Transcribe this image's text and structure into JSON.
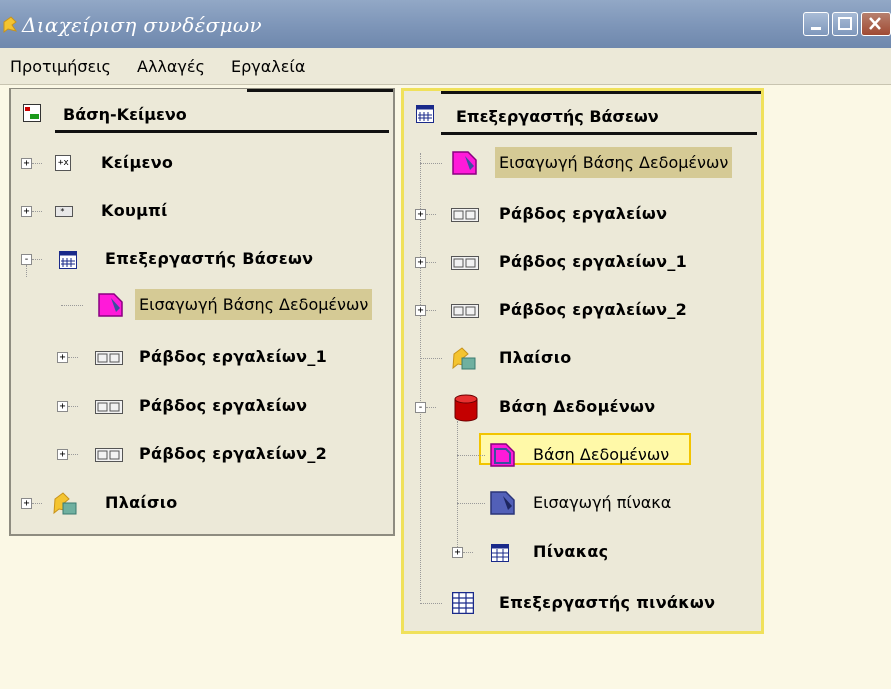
{
  "window": {
    "title": "Διαχείριση συνδέσμων",
    "controls": [
      "minimize",
      "maximize",
      "close"
    ]
  },
  "menu": {
    "items": [
      "Προτιμήσεις",
      "Αλλαγές",
      "Εργαλεία"
    ]
  },
  "left_panel": {
    "header": {
      "label": "Βάση-Κείμενο",
      "icon": "form-icon"
    },
    "rows": [
      {
        "label": "Κείμενο",
        "icon": "textbox-icon",
        "expander": "+"
      },
      {
        "label": "Κουμπί",
        "icon": "button-icon",
        "expander": "+"
      },
      {
        "label": "Επεξεργαστής Βάσεων",
        "icon": "calendar-grid-icon",
        "expander": "-"
      },
      {
        "label": "Εισαγωγή Βάσης Δεδομένων",
        "icon": "db-import-icon",
        "expander": "",
        "highlighted": true
      },
      {
        "label": "Ράβδος εργαλείων_1",
        "icon": "toolbar-icon",
        "expander": "+"
      },
      {
        "label": "Ράβδος εργαλείων",
        "icon": "toolbar-icon",
        "expander": "+"
      },
      {
        "label": "Ράβδος εργαλείων_2",
        "icon": "toolbar-icon",
        "expander": "+"
      },
      {
        "label": "Πλαίσιο",
        "icon": "frame-icon",
        "expander": "+"
      }
    ]
  },
  "right_panel": {
    "header": {
      "label": "Επεξεργαστής Βάσεων",
      "icon": "calendar-grid-icon"
    },
    "rows": [
      {
        "label": "Εισαγωγή Βάσης Δεδομένων",
        "icon": "db-import-icon",
        "expander": "",
        "highlighted": true
      },
      {
        "label": "Ράβδος εργαλείων",
        "icon": "toolbar-icon",
        "expander": "+"
      },
      {
        "label": "Ράβδος εργαλείων_1",
        "icon": "toolbar-icon",
        "expander": "+"
      },
      {
        "label": "Ράβδος εργαλείων_2",
        "icon": "toolbar-icon",
        "expander": "+"
      },
      {
        "label": "Πλαίσιο",
        "icon": "frame-icon",
        "expander": ""
      },
      {
        "label": "Βάση Δεδομένων",
        "icon": "database-icon",
        "expander": "-"
      },
      {
        "label": "Βάση Δεδομένων",
        "icon": "db-item-icon",
        "expander": "",
        "selected": true
      },
      {
        "label": "Εισαγωγή πίνακα",
        "icon": "table-import-icon",
        "expander": ""
      },
      {
        "label": "Πίνακας",
        "icon": "table-icon",
        "expander": "+"
      },
      {
        "label": "Επεξεργαστής πινάκων",
        "icon": "table-editor-icon",
        "expander": ""
      }
    ]
  },
  "colors": {
    "titlebar": "#7d95b8",
    "background": "#fbf8e5",
    "panel": "#ece9d8",
    "highlight": "#d5ca95",
    "selection_border": "#f2c400"
  }
}
